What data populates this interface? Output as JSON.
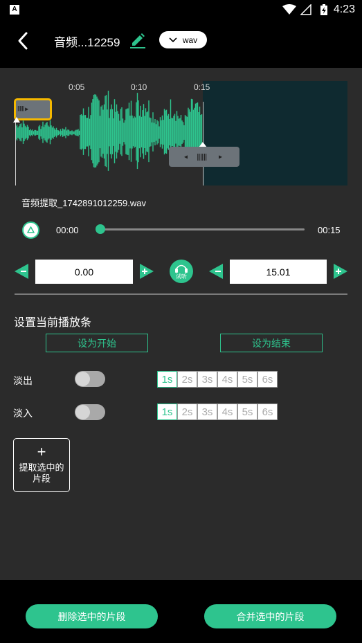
{
  "statusbar": {
    "time": "4:23",
    "app_badge": "A"
  },
  "header": {
    "title": "音频...12259",
    "format": "wav"
  },
  "waveform": {
    "ticks": [
      "0:05",
      "0:10",
      "0:15"
    ]
  },
  "file": {
    "name": "音频提取_1742891012259.wav"
  },
  "player": {
    "current_time": "00:00",
    "duration": "00:15",
    "progress": 0.0
  },
  "range": {
    "start_value": "0.00",
    "end_value": "15.01",
    "listen_label": "试听"
  },
  "section": {
    "title": "设置当前播放条",
    "set_start": "设为开始",
    "set_end": "设为结束"
  },
  "fade_out": {
    "label": "淡出",
    "enabled": false,
    "options": [
      "1s",
      "2s",
      "3s",
      "4s",
      "5s",
      "6s"
    ],
    "selected": "1s"
  },
  "fade_in": {
    "label": "淡入",
    "enabled": false,
    "options": [
      "1s",
      "2s",
      "3s",
      "4s",
      "5s",
      "6s"
    ],
    "selected": "1s"
  },
  "extract": {
    "label": "提取选中的片段"
  },
  "actions": {
    "delete": "删除选中的片段",
    "merge": "合并选中的片段"
  },
  "colors": {
    "accent": "#2ec48e",
    "handle_border": "#f5b800",
    "unselected_bg": "#0f2a30"
  }
}
